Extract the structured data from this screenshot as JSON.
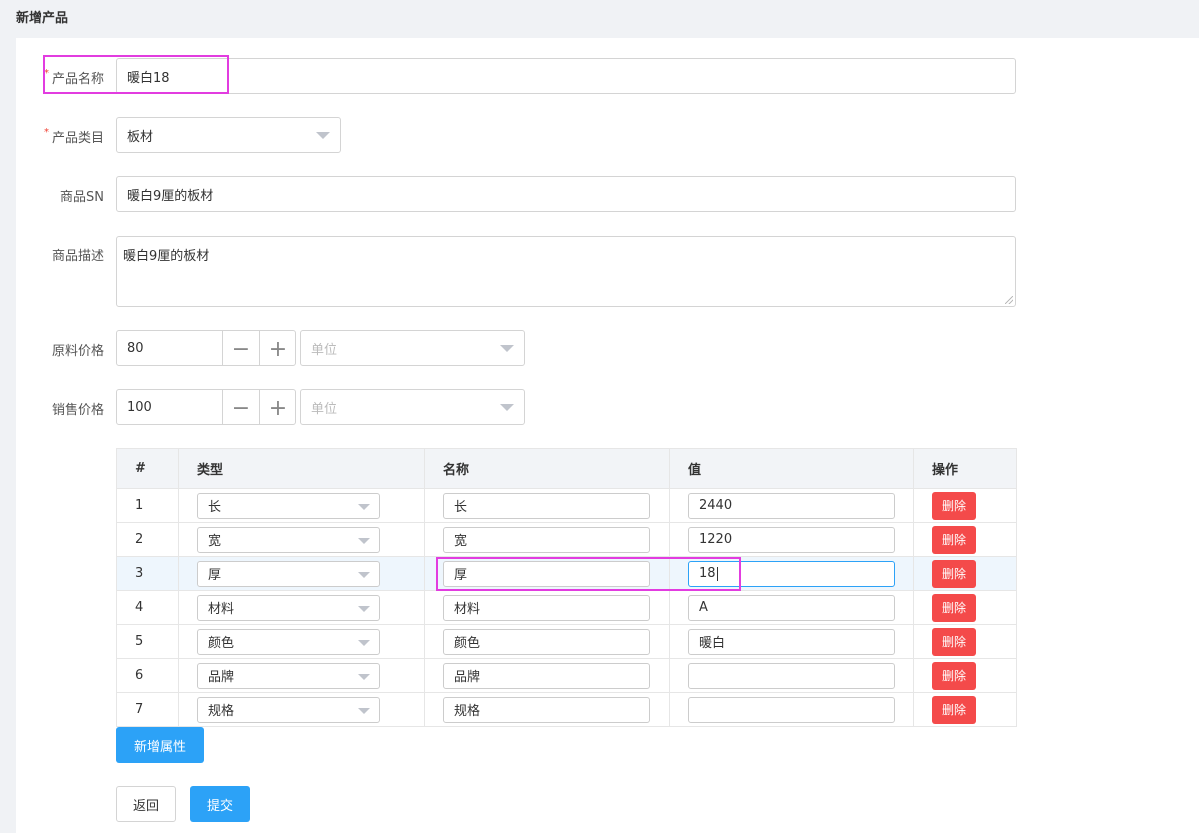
{
  "page": {
    "title": "新增产品"
  },
  "form": {
    "name": {
      "label": "产品名称",
      "required_mark": "*",
      "value": "暖白18"
    },
    "category": {
      "label": "产品类目",
      "required_mark": "*",
      "value": "板材"
    },
    "sn": {
      "label": "商品SN",
      "value": "暖白9厘的板材"
    },
    "description": {
      "label": "商品描述",
      "value": "暖白9厘的板材"
    },
    "raw_price": {
      "label": "原料价格",
      "value": "80",
      "minus": "−",
      "plus": "+",
      "unit_placeholder": "单位"
    },
    "sale_price": {
      "label": "销售价格",
      "value": "100",
      "minus": "−",
      "plus": "+",
      "unit_placeholder": "单位"
    }
  },
  "attributes_table": {
    "headers": [
      "#",
      "类型",
      "名称",
      "值",
      "操作"
    ],
    "rows": [
      {
        "index": "1",
        "type": "长",
        "name": "长",
        "value": "2440",
        "action": "删除"
      },
      {
        "index": "2",
        "type": "宽",
        "name": "宽",
        "value": "1220",
        "action": "删除"
      },
      {
        "index": "3",
        "type": "厚",
        "name": "厚",
        "value": "18",
        "action": "删除"
      },
      {
        "index": "4",
        "type": "材料",
        "name": "材料",
        "value": "A",
        "action": "删除"
      },
      {
        "index": "5",
        "type": "颜色",
        "name": "颜色",
        "value": "暖白",
        "action": "删除"
      },
      {
        "index": "6",
        "type": "品牌",
        "name": "品牌",
        "value": "",
        "action": "删除"
      },
      {
        "index": "7",
        "type": "规格",
        "name": "规格",
        "value": "",
        "action": "删除"
      }
    ]
  },
  "buttons": {
    "add_attribute": "新增属性",
    "back": "返回",
    "submit": "提交"
  },
  "colors": {
    "primary": "#2ca2f7",
    "danger": "#f44a4a",
    "highlight": "#e23ce0",
    "required": "#f04134"
  }
}
